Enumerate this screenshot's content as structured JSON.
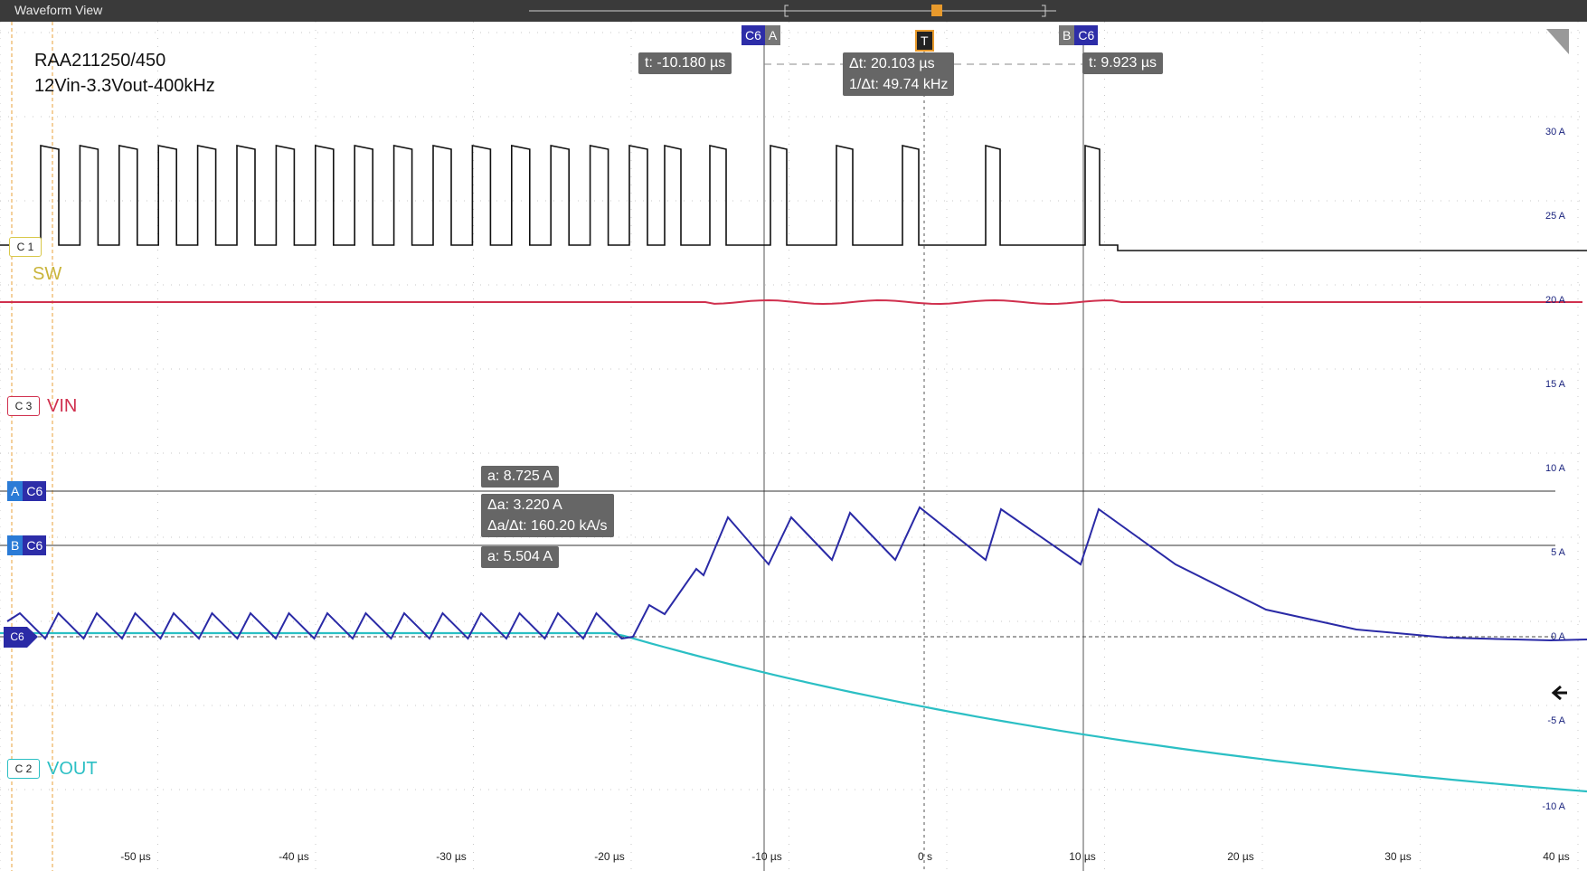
{
  "window": {
    "title": "Waveform View"
  },
  "info": {
    "line1": "RAA211250/450",
    "line2": "12Vin-3.3Vout-400kHz"
  },
  "channels": {
    "c1": {
      "badge": "C 1",
      "name": "SW",
      "color": "#111111"
    },
    "c3": {
      "badge": "C 3",
      "name": "VIN",
      "color": "#d0304e"
    },
    "c2": {
      "badge": "C 2",
      "name": "VOUT",
      "color": "#2bbfc4"
    },
    "c6": {
      "badge": "C6",
      "color": "#2a2aa6"
    }
  },
  "y_axis_labels": [
    "30 A",
    "25 A",
    "20 A",
    "15 A",
    "10 A",
    "5 A",
    "0 A",
    "-5 A",
    "-10 A"
  ],
  "x_axis_labels": [
    "-50 µs",
    "-40 µs",
    "-30 µs",
    "-20 µs",
    "-10 µs",
    "0 s",
    "10 µs",
    "20 µs",
    "30 µs",
    "40 µs"
  ],
  "cursors": {
    "vertical_a": {
      "tag_channel": "C6",
      "tag_letter": "A",
      "readout": "t: -10.180 µs"
    },
    "vertical_b": {
      "tag_channel": "C6",
      "tag_letter": "B",
      "readout": "t: 9.923 µs"
    },
    "trigger": {
      "label": "T"
    },
    "delta_t": "Δt: 20.103 µs",
    "inv_delta_t": "1/Δt: 49.74 kHz",
    "horizontal_a": {
      "letter": "A",
      "channel": "C6",
      "readout": "a: 8.725 A"
    },
    "horizontal_b": {
      "letter": "B",
      "channel": "C6",
      "readout": "a: 5.504 A"
    },
    "delta_a": "Δa: 3.220 A",
    "delta_a_rate": "Δa/Δt: 160.20 kA/s"
  }
}
